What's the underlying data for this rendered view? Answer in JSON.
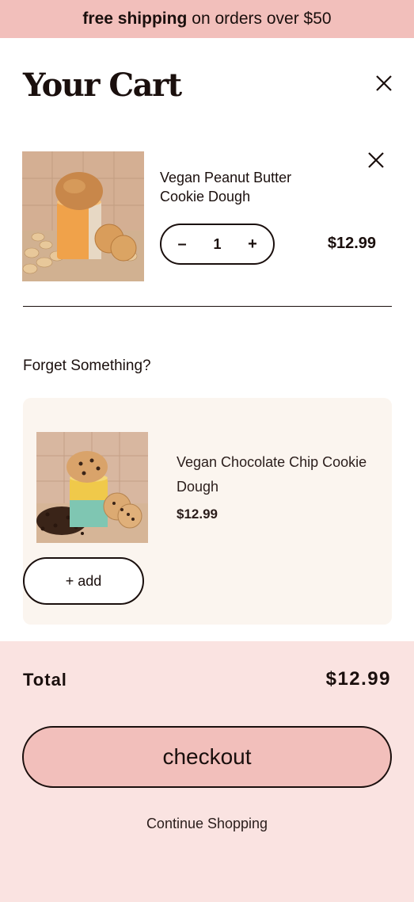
{
  "banner": {
    "bold_text": "free shipping",
    "rest_text": "on orders over $50"
  },
  "cart": {
    "title": "Your Cart",
    "items": [
      {
        "name": "Vegan Peanut Butter Cookie Dough",
        "quantity": "1",
        "decrement_label": "–",
        "increment_label": "+",
        "price": "$12.99"
      }
    ]
  },
  "upsell": {
    "heading": "Forget Something?",
    "product": {
      "name": "Vegan Chocolate Chip Cookie Dough",
      "price": "$12.99",
      "add_label": "+ add"
    }
  },
  "summary": {
    "total_label": "Total",
    "total_value": "$12.99",
    "checkout_label": "checkout",
    "continue_label": "Continue Shopping"
  },
  "icons": {
    "close_cart": "close-icon",
    "remove_item": "close-icon"
  },
  "colors": {
    "banner_bg": "#f2bfbb",
    "footer_bg": "#fae3e1",
    "card_bg": "#fbf5ef",
    "checkout_bg": "#f2bfbb",
    "text": "#1a0f0d"
  }
}
